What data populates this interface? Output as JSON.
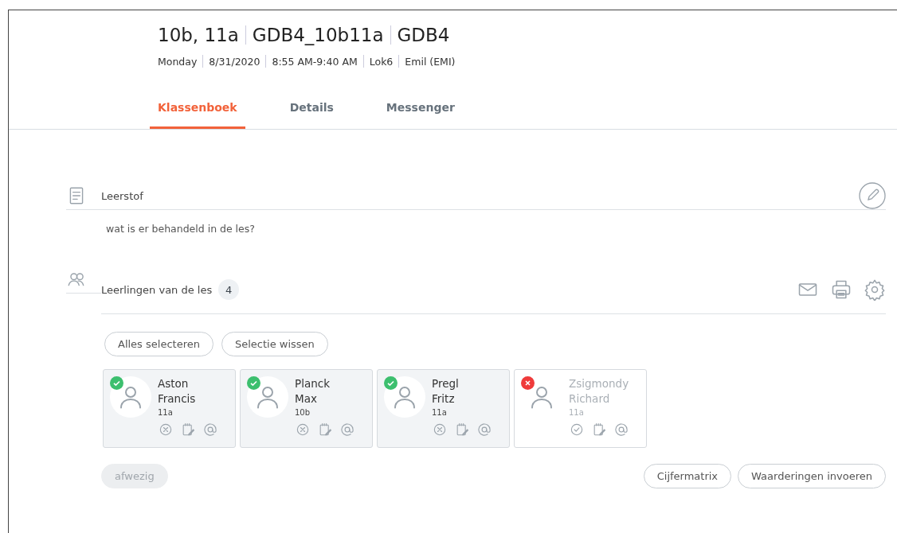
{
  "header": {
    "title_parts": [
      "10b, 11a",
      "GDB4_10b11a",
      "GDB4"
    ],
    "meta": [
      "Monday",
      "8/31/2020",
      "8:55 AM-9:40 AM",
      "Lok6",
      "Emil (EMI)"
    ]
  },
  "tabs": [
    {
      "label": "Klassenboek",
      "selected": true
    },
    {
      "label": "Details",
      "selected": false
    },
    {
      "label": "Messenger",
      "selected": false
    }
  ],
  "leerstof": {
    "title": "Leerstof",
    "text": "wat is er behandeld in de les?"
  },
  "students_section": {
    "title": "Leerlingen van de les",
    "count": "4",
    "buttons": [
      "Alles selecteren",
      "Selectie wissen"
    ]
  },
  "students": [
    {
      "last_name": "Aston",
      "first_name": "Francis",
      "class": "11a",
      "present": true
    },
    {
      "last_name": "Planck",
      "first_name": "Max",
      "class": "10b",
      "present": true
    },
    {
      "last_name": "Pregl",
      "first_name": "Fritz",
      "class": "11a",
      "present": true
    },
    {
      "last_name": "Zsigmondy",
      "first_name": "Richard",
      "class": "11a",
      "present": false
    }
  ],
  "footer": {
    "absent_button": {
      "label": "afwezig",
      "disabled": true
    },
    "buttons": [
      "Cijfermatrix",
      "Waarderingen invoeren"
    ]
  }
}
